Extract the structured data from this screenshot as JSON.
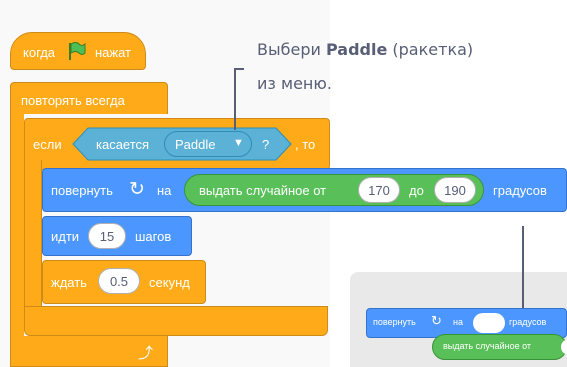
{
  "callout": {
    "line1_prefix": "Выбери",
    "line1_bold": "Paddle",
    "line1_suffix": "(ракетка)",
    "line2": "из меню."
  },
  "hat": {
    "prefix": "когда",
    "suffix": "нажат",
    "icon": "green-flag-icon"
  },
  "forever": {
    "label": "повторять всегда"
  },
  "if_block": {
    "if_label": "если",
    "then_label": ", то"
  },
  "touching": {
    "label": "касается",
    "dropdown_value": "Paddle",
    "question": "?"
  },
  "turn": {
    "label": "повернуть",
    "on": "на",
    "suffix": "градусов"
  },
  "random": {
    "label": "выдать случайное от",
    "from": "170",
    "to_label": "до",
    "to": "190"
  },
  "move": {
    "label": "идти",
    "value": "15",
    "suffix": "шагов"
  },
  "wait": {
    "label": "ждать",
    "value": "0.5",
    "suffix": "секунд"
  },
  "example": {
    "turn_label": "повернуть",
    "on": "на",
    "suffix": "градусов",
    "random_label": "выдать случайное от"
  },
  "colors": {
    "control": "#ffab19",
    "motion": "#4c97ff",
    "operators": "#59c059",
    "sensing": "#5cb1d6"
  }
}
